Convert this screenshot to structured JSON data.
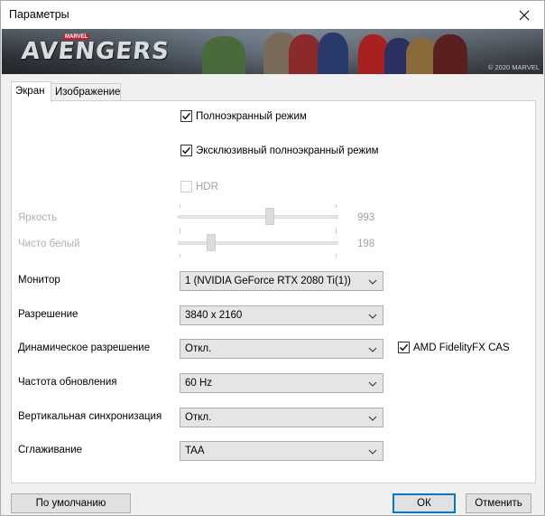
{
  "window": {
    "title": "Параметры"
  },
  "banner": {
    "logo_small": "MARVEL",
    "logo": "AVENGERS",
    "copyright": "© 2020 MARVEL"
  },
  "tabs": [
    {
      "label": "Экран",
      "active": true
    },
    {
      "label": "Изображение",
      "active": false
    }
  ],
  "display": {
    "fullscreen": {
      "label": "Полноэкранный режим",
      "checked": true
    },
    "exclusive_fullscreen": {
      "label": "Эксклюзивный полноэкранный режим",
      "checked": true
    },
    "hdr": {
      "label": "HDR",
      "checked": false,
      "enabled": false
    },
    "brightness": {
      "label": "Яркость",
      "value": "993",
      "fraction": 0.58
    },
    "pure_white": {
      "label": "Чисто белый",
      "value": "198",
      "fraction": 0.19
    },
    "monitor": {
      "label": "Монитор",
      "value": "1 (NVIDIA GeForce RTX 2080 Ti(1))"
    },
    "resolution": {
      "label": "Разрешение",
      "value": "3840 x 2160"
    },
    "dynamic_resolution": {
      "label": "Динамическое разрешение",
      "value": "Откл."
    },
    "fidelityfx": {
      "label": "AMD FidelityFX CAS",
      "checked": true
    },
    "refresh_rate": {
      "label": "Частота обновления",
      "value": "60 Hz"
    },
    "vsync": {
      "label": "Вертикальная синхронизация",
      "value": "Откл."
    },
    "antialiasing": {
      "label": "Сглаживание",
      "value": "TAA"
    }
  },
  "buttons": {
    "defaults": "По умолчанию",
    "ok": "ОК",
    "cancel": "Отменить"
  }
}
